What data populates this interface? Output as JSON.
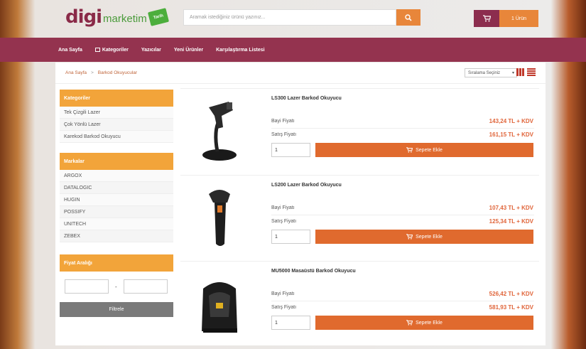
{
  "header": {
    "logo_main": "digi",
    "logo_sub": "marketim",
    "logo_badge": "Tarih",
    "search_placeholder": "Aramak istediğiniz ürünü yazınız...",
    "cart_count": "1 Ürün"
  },
  "nav": [
    "Ana Sayfa",
    "Kategoriler",
    "Yazıcılar",
    "Yeni Ürünler",
    "Karşılaştırma Listesi"
  ],
  "breadcrumb": [
    "Ana Sayfa",
    "Barkod Okuyucular"
  ],
  "breadcrumb_sep": ">",
  "sort_label": "Sıralama Seçiniz",
  "sidebar": {
    "categories_title": "Kategoriler",
    "categories": [
      "Tek Çizgili Lazer",
      "Çok Yönlü Lazer",
      "Karekod Barkod Okuyucu"
    ],
    "brands_title": "Markalar",
    "brands": [
      "ARGOX",
      "DATALOGIC",
      "HUGIN",
      "POSSIFY",
      "UNITECH",
      "ZEBEX"
    ],
    "price_title": "Fiyat Aralığı",
    "price_dash": "-",
    "filter_button": "Filtrele"
  },
  "products": [
    {
      "name": "LS300 Lazer Barkod Okuyucu",
      "dealer_label": "Bayi Fiyatı",
      "dealer_price": "143,24 TL + KDV",
      "sale_label": "Satış Fiyatı",
      "sale_price": "161,15 TL + KDV",
      "qty": "1",
      "add_label": "Sepete Ekle"
    },
    {
      "name": "LS200 Lazer Barkod Okuyucu",
      "dealer_label": "Bayi Fiyatı",
      "dealer_price": "107,43 TL + KDV",
      "sale_label": "Satış Fiyatı",
      "sale_price": "125,34 TL + KDV",
      "qty": "1",
      "add_label": "Sepete Ekle"
    },
    {
      "name": "MU5000 Masaüstü Barkod Okuyucu",
      "dealer_label": "Bayi Fiyatı",
      "dealer_price": "526,42 TL + KDV",
      "sale_label": "Satış Fiyatı",
      "sale_price": "581,93 TL + KDV",
      "qty": "1",
      "add_label": "Sepete Ekle"
    }
  ],
  "colors": {
    "brand": "#94334f",
    "accent": "#e8863a",
    "price": "#e0653a"
  }
}
